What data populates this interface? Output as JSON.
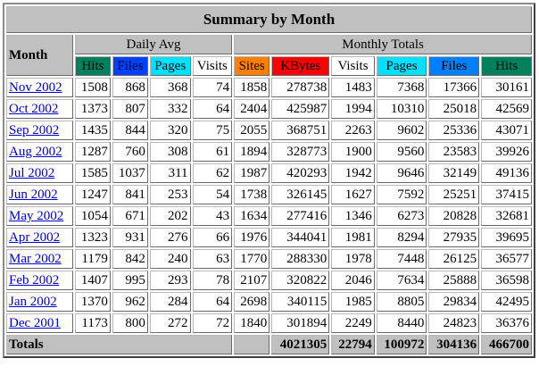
{
  "title": "Summary by Month",
  "month_header": "Month",
  "groups": {
    "daily_avg": "Daily Avg",
    "monthly_totals": "Monthly Totals"
  },
  "columns": [
    {
      "label": "Hits",
      "bg": "#00805c"
    },
    {
      "label": "Files",
      "bg": "#0040ff"
    },
    {
      "label": "Pages",
      "bg": "#00e0ff"
    },
    {
      "label": "Visits",
      "bg": "#ffffff"
    },
    {
      "label": "Sites",
      "bg": "#ff8000"
    },
    {
      "label": "KBytes",
      "bg": "#ff0000"
    },
    {
      "label": "Visits",
      "bg": "#ffffff"
    },
    {
      "label": "Pages",
      "bg": "#00e0ff"
    },
    {
      "label": "Files",
      "bg": "#0080ff"
    },
    {
      "label": "Hits",
      "bg": "#00805c"
    }
  ],
  "rows": [
    {
      "month": "Nov 2002",
      "values": [
        "1508",
        "868",
        "368",
        "74",
        "1858",
        "278738",
        "1483",
        "7368",
        "17366",
        "30161"
      ]
    },
    {
      "month": "Oct 2002",
      "values": [
        "1373",
        "807",
        "332",
        "64",
        "2404",
        "425987",
        "1994",
        "10310",
        "25018",
        "42569"
      ]
    },
    {
      "month": "Sep 2002",
      "values": [
        "1435",
        "844",
        "320",
        "75",
        "2055",
        "368751",
        "2263",
        "9602",
        "25336",
        "43071"
      ]
    },
    {
      "month": "Aug 2002",
      "values": [
        "1287",
        "760",
        "308",
        "61",
        "1894",
        "328773",
        "1900",
        "9560",
        "23583",
        "39926"
      ]
    },
    {
      "month": "Jul 2002",
      "values": [
        "1585",
        "1037",
        "311",
        "62",
        "1987",
        "420293",
        "1942",
        "9646",
        "32149",
        "49136"
      ]
    },
    {
      "month": "Jun 2002",
      "values": [
        "1247",
        "841",
        "253",
        "54",
        "1738",
        "326145",
        "1627",
        "7592",
        "25251",
        "37415"
      ]
    },
    {
      "month": "May 2002",
      "values": [
        "1054",
        "671",
        "202",
        "43",
        "1634",
        "277416",
        "1346",
        "6273",
        "20828",
        "32681"
      ]
    },
    {
      "month": "Apr 2002",
      "values": [
        "1323",
        "931",
        "276",
        "66",
        "1976",
        "344041",
        "1981",
        "8294",
        "27935",
        "39695"
      ]
    },
    {
      "month": "Mar 2002",
      "values": [
        "1179",
        "842",
        "240",
        "63",
        "1770",
        "288330",
        "1978",
        "7448",
        "26125",
        "36577"
      ]
    },
    {
      "month": "Feb 2002",
      "values": [
        "1407",
        "995",
        "293",
        "78",
        "2107",
        "320822",
        "2046",
        "7634",
        "25888",
        "36598"
      ]
    },
    {
      "month": "Jan 2002",
      "values": [
        "1370",
        "962",
        "284",
        "64",
        "2698",
        "340115",
        "1985",
        "8805",
        "29834",
        "42495"
      ]
    },
    {
      "month": "Dec 2001",
      "values": [
        "1173",
        "800",
        "272",
        "72",
        "1840",
        "301894",
        "2249",
        "8440",
        "24823",
        "36376"
      ]
    }
  ],
  "totals": {
    "label": "Totals",
    "kbytes": "4021305",
    "visits": "22794",
    "pages": "100972",
    "files": "304136",
    "hits": "466700"
  }
}
